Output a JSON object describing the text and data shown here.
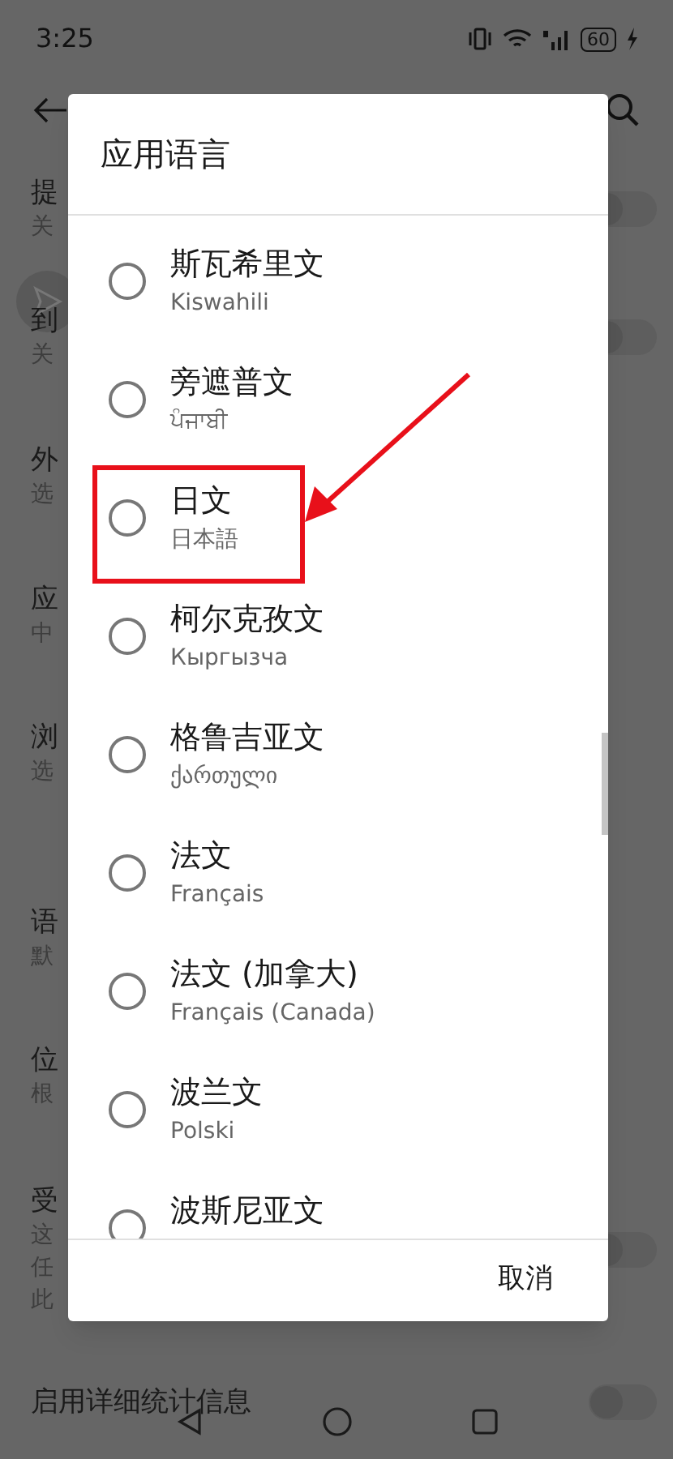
{
  "status_bar": {
    "time": "3:25",
    "battery": "60"
  },
  "background_rows": [
    {
      "lines": [
        "提",
        "关"
      ],
      "switch_on": false
    },
    {
      "lines": [
        "到",
        "关"
      ],
      "switch_on": false
    },
    {
      "lines": [
        "外",
        "选"
      ]
    },
    {
      "lines": [
        "应",
        "中"
      ]
    },
    {
      "lines": [
        "浏",
        "选"
      ]
    },
    {
      "lines": [
        "语",
        "默"
      ]
    },
    {
      "lines": [
        "位",
        "根"
      ]
    },
    {
      "lines": [
        "受",
        "这",
        "任",
        "此"
      ],
      "switch_on": false
    },
    {
      "lines": [
        "启用详细统计信息"
      ],
      "switch_on": false
    }
  ],
  "dialog": {
    "title": "应用语言",
    "options": [
      {
        "name": "斯瓦希里文",
        "native": "Kiswahili",
        "selected": false
      },
      {
        "name": "旁遮普文",
        "native": "ਪੰਜਾਬੀ",
        "selected": false
      },
      {
        "name": "日文",
        "native": "日本語",
        "selected": false
      },
      {
        "name": "柯尔克孜文",
        "native": "Кыргызча",
        "selected": false
      },
      {
        "name": "格鲁吉亚文",
        "native": "ქართული",
        "selected": false
      },
      {
        "name": "法文",
        "native": "Français",
        "selected": false
      },
      {
        "name": "法文 (加拿大)",
        "native": "Français (Canada)",
        "selected": false
      },
      {
        "name": "波兰文",
        "native": "Polski",
        "selected": false
      },
      {
        "name": "波斯尼亚文",
        "selected": false
      }
    ],
    "cancel": "取消"
  }
}
